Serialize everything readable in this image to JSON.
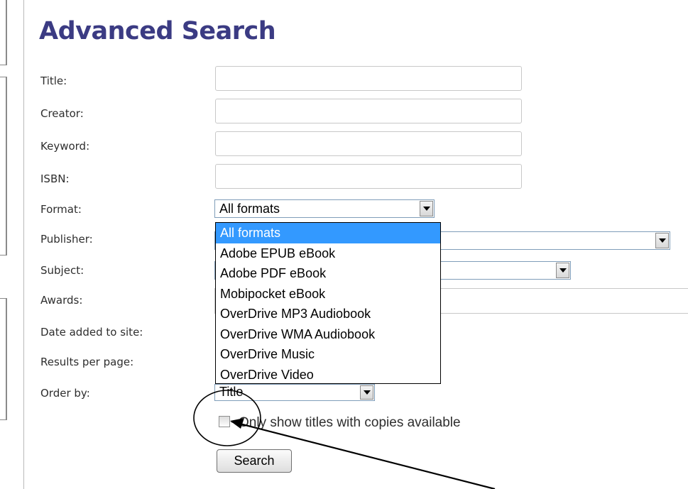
{
  "page": {
    "title": "Advanced Search"
  },
  "form": {
    "labels": {
      "title": "Title:",
      "creator": "Creator:",
      "keyword": "Keyword:",
      "isbn": "ISBN:",
      "format": "Format:",
      "publisher": "Publisher:",
      "subject": "Subject:",
      "awards": "Awards:",
      "date_added": "Date added to site:",
      "results_per_page": "Results per page:",
      "order_by": "Order by:"
    },
    "inputs": {
      "title": "",
      "creator": "",
      "keyword": "",
      "isbn": ""
    },
    "format": {
      "selected": "All formats",
      "options": [
        "All formats",
        "Adobe EPUB eBook",
        "Adobe PDF eBook",
        "Mobipocket eBook",
        "OverDrive MP3 Audiobook",
        "OverDrive WMA Audiobook",
        "OverDrive Music",
        "OverDrive Video"
      ],
      "highlighted_option": "All formats",
      "expanded": true
    },
    "publisher": {
      "selected": ""
    },
    "subject": {
      "selected": ""
    },
    "order_by": {
      "selected": "Title"
    },
    "copies_available": {
      "label": "Only show titles with copies available",
      "checked": false
    },
    "search_button": "Search"
  },
  "icons": {
    "dropdown_arrow": "chevron-down-icon",
    "annotation": "circle-and-arrow-annotation"
  },
  "colors": {
    "title": "#3b3b83",
    "selected_option": "#3399ff"
  }
}
